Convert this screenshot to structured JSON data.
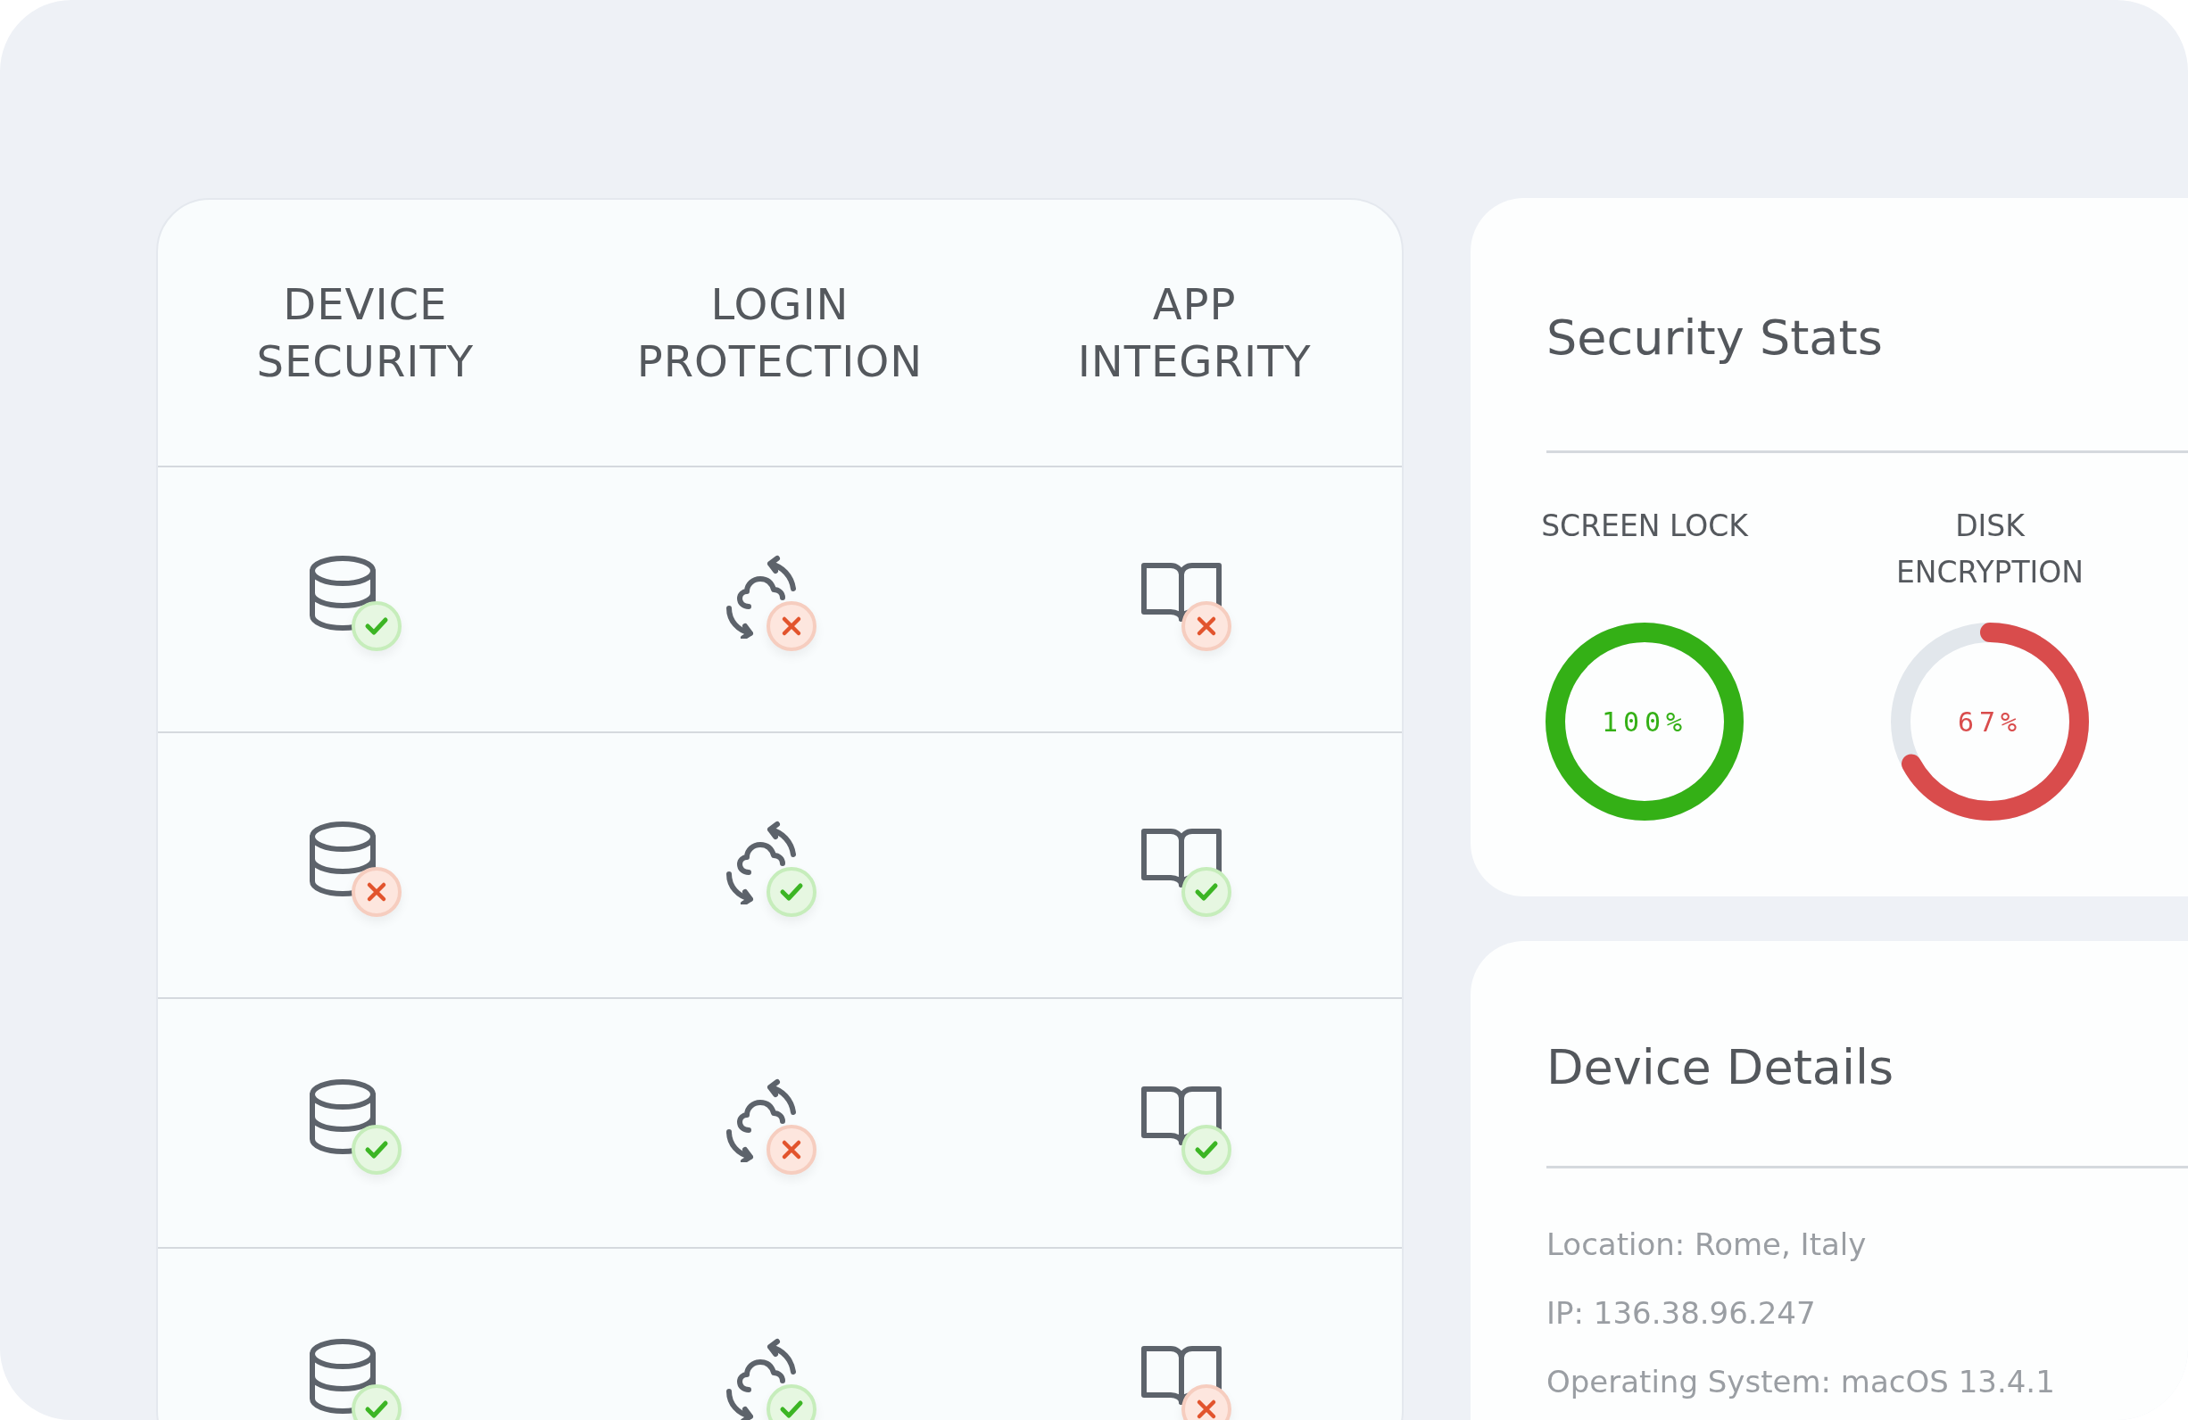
{
  "table": {
    "columns": [
      "DEVICE\nSECURITY",
      "LOGIN\nPROTECTION",
      "APP\nINTEGRITY"
    ],
    "rows": [
      {
        "cells": [
          {
            "passed": true
          },
          {
            "passed": false
          },
          {
            "passed": false
          }
        ]
      },
      {
        "cells": [
          {
            "passed": false
          },
          {
            "passed": true
          },
          {
            "passed": true
          }
        ]
      },
      {
        "cells": [
          {
            "passed": true
          },
          {
            "passed": false
          },
          {
            "passed": true
          }
        ]
      },
      {
        "cells": [
          {
            "passed": true
          },
          {
            "passed": true
          },
          {
            "passed": false
          }
        ]
      }
    ]
  },
  "security_stats": {
    "title": "Security Stats",
    "gauges": [
      {
        "label": "SCREEN LOCK",
        "level": 1,
        "reading": "100%",
        "color": "#34b016"
      },
      {
        "label": "DISK\nENCRYPTION",
        "level": 0.67,
        "reading": "67%",
        "color": "#d94c4c"
      }
    ]
  },
  "device_details": {
    "title": "Device Details",
    "lines": [
      "Location: Rome, Italy",
      "IP: 136.38.96.247",
      "Operating System: macOS 13.4.1"
    ]
  }
}
